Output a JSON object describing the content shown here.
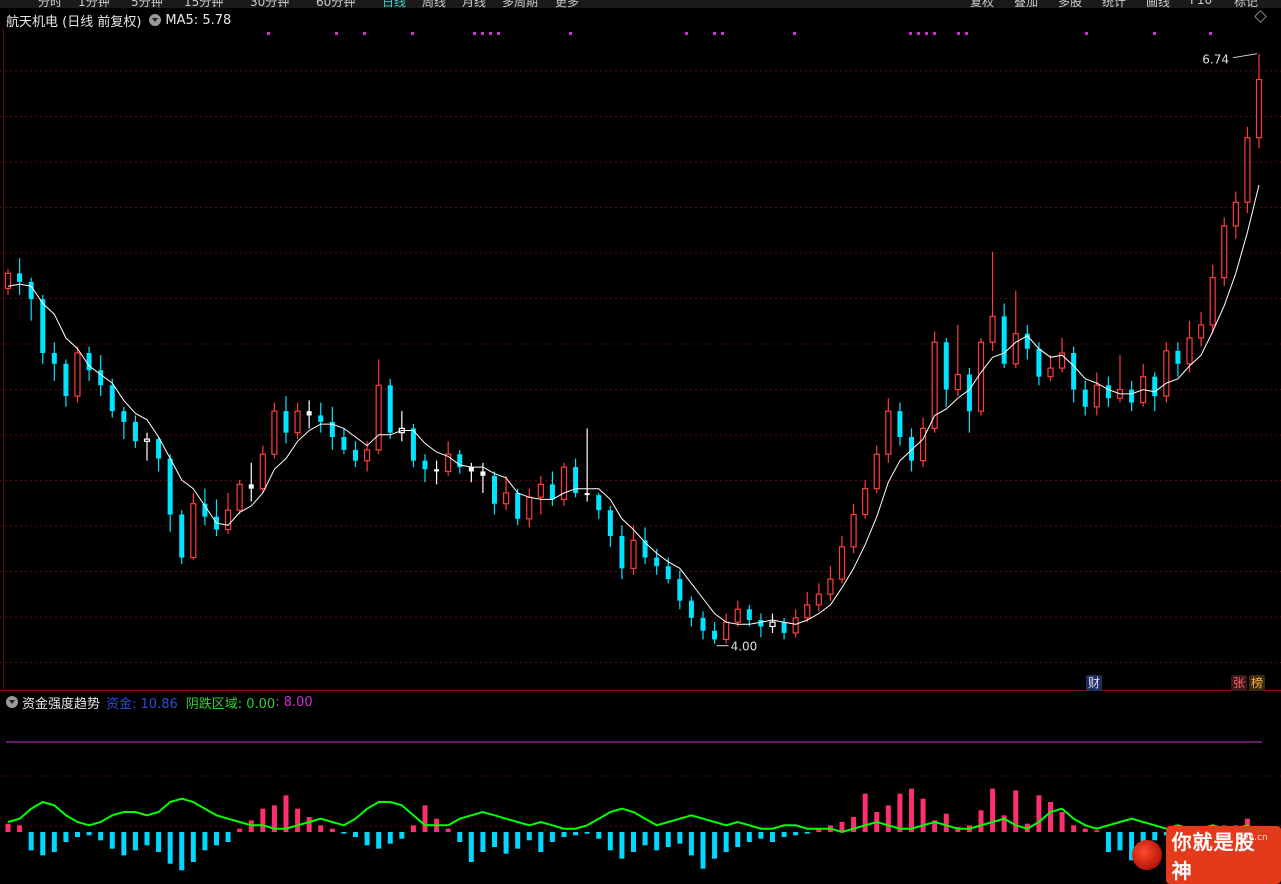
{
  "toolbar": {
    "left_tabs": [
      "分时",
      "1分钟",
      "5分钟",
      "15分钟",
      "30分钟",
      "60分钟",
      "日线",
      "周线",
      "月线",
      "多周期",
      "更多"
    ],
    "right_tabs": [
      "复权",
      "叠加",
      "多股",
      "统计",
      "画线",
      "F10",
      "标记"
    ],
    "active": "日线"
  },
  "main_header": {
    "stock": "航天机电 (日线 前复权)",
    "ma_label": "MA5: 5.78"
  },
  "sub_header": {
    "indicator": "资金强度趋势",
    "fund_label": "资金: 10.86",
    "neg_label": "阴跌区域: 0.00",
    "level_label": ": 8.00"
  },
  "tags": {
    "cai": "财",
    "zhang": "张",
    "bang": "榜"
  },
  "watermark": {
    "text": "你就是股神",
    "url": "694.cn"
  },
  "colors": {
    "up": "#ff3b3b",
    "down": "#00e5ff",
    "doji": "#ffffff",
    "ma": "#ffffff",
    "line_green": "#00ff00",
    "line_purple": "#d030d0",
    "bar_pos": "#ff2e6c",
    "bar_neg": "#00d8ff",
    "grid": "#5a0a0a"
  },
  "chart_data": [
    {
      "type": "candlestick",
      "title": "航天机电 (日线 前复权)",
      "series_name": "MA5",
      "ylim": [
        3.85,
        6.85
      ],
      "high_label": "6.74",
      "low_label": "4.00",
      "candles": [
        [
          5.65,
          5.72,
          5.74,
          5.62
        ],
        [
          5.72,
          5.68,
          5.79,
          5.62
        ],
        [
          5.68,
          5.6,
          5.7,
          5.5
        ],
        [
          5.6,
          5.35,
          5.62,
          5.3
        ],
        [
          5.35,
          5.3,
          5.4,
          5.22
        ],
        [
          5.3,
          5.15,
          5.32,
          5.1
        ],
        [
          5.15,
          5.35,
          5.38,
          5.12
        ],
        [
          5.35,
          5.27,
          5.38,
          5.22
        ],
        [
          5.27,
          5.2,
          5.34,
          5.15
        ],
        [
          5.2,
          5.08,
          5.23,
          5.05
        ],
        [
          5.08,
          5.03,
          5.1,
          4.95
        ],
        [
          5.03,
          4.94,
          5.06,
          4.91
        ],
        [
          4.94,
          4.95,
          4.98,
          4.85
        ],
        [
          4.95,
          4.86,
          4.96,
          4.8
        ],
        [
          4.86,
          4.6,
          4.88,
          4.52
        ],
        [
          4.6,
          4.4,
          4.62,
          4.37
        ],
        [
          4.4,
          4.65,
          4.7,
          4.39
        ],
        [
          4.65,
          4.59,
          4.72,
          4.55
        ],
        [
          4.59,
          4.53,
          4.67,
          4.5
        ],
        [
          4.53,
          4.62,
          4.7,
          4.51
        ],
        [
          4.62,
          4.74,
          4.76,
          4.6
        ],
        [
          4.74,
          4.72,
          4.84,
          4.66
        ],
        [
          4.72,
          4.88,
          4.92,
          4.7
        ],
        [
          4.88,
          5.08,
          5.12,
          4.86
        ],
        [
          5.08,
          4.98,
          5.15,
          4.93
        ],
        [
          4.98,
          5.08,
          5.12,
          4.95
        ],
        [
          5.08,
          5.06,
          5.13,
          5.0
        ],
        [
          5.06,
          5.03,
          5.12,
          4.98
        ],
        [
          5.03,
          4.96,
          5.1,
          4.9
        ],
        [
          4.96,
          4.9,
          5.0,
          4.88
        ],
        [
          4.9,
          4.85,
          4.94,
          4.82
        ],
        [
          4.85,
          4.9,
          4.94,
          4.8
        ],
        [
          4.9,
          5.2,
          5.32,
          4.88
        ],
        [
          5.2,
          4.98,
          5.23,
          4.95
        ],
        [
          4.98,
          5.0,
          5.08,
          4.94
        ],
        [
          5.0,
          4.85,
          5.02,
          4.82
        ],
        [
          4.85,
          4.81,
          4.88,
          4.75
        ],
        [
          4.81,
          4.8,
          4.85,
          4.74
        ],
        [
          4.8,
          4.88,
          4.94,
          4.78
        ],
        [
          4.88,
          4.82,
          4.9,
          4.79
        ],
        [
          4.82,
          4.8,
          4.84,
          4.75
        ],
        [
          4.8,
          4.78,
          4.84,
          4.7
        ],
        [
          4.78,
          4.65,
          4.8,
          4.6
        ],
        [
          4.65,
          4.7,
          4.78,
          4.62
        ],
        [
          4.7,
          4.58,
          4.72,
          4.55
        ],
        [
          4.58,
          4.68,
          4.72,
          4.54
        ],
        [
          4.68,
          4.74,
          4.78,
          4.6
        ],
        [
          4.74,
          4.67,
          4.8,
          4.64
        ],
        [
          4.67,
          4.82,
          4.84,
          4.64
        ],
        [
          4.82,
          4.7,
          4.86,
          4.68
        ],
        [
          4.7,
          4.69,
          5.0,
          4.66
        ],
        [
          4.69,
          4.62,
          4.7,
          4.58
        ],
        [
          4.62,
          4.5,
          4.64,
          4.45
        ],
        [
          4.5,
          4.35,
          4.55,
          4.3
        ],
        [
          4.35,
          4.48,
          4.55,
          4.32
        ],
        [
          4.48,
          4.4,
          4.54,
          4.37
        ],
        [
          4.4,
          4.36,
          4.44,
          4.32
        ],
        [
          4.36,
          4.3,
          4.4,
          4.28
        ],
        [
          4.3,
          4.2,
          4.34,
          4.16
        ],
        [
          4.2,
          4.12,
          4.22,
          4.08
        ],
        [
          4.12,
          4.06,
          4.15,
          4.02
        ],
        [
          4.06,
          4.02,
          4.1,
          4.0
        ],
        [
          4.02,
          4.1,
          4.14,
          4.0
        ],
        [
          4.1,
          4.16,
          4.2,
          4.08
        ],
        [
          4.16,
          4.11,
          4.18,
          4.08
        ],
        [
          4.11,
          4.08,
          4.14,
          4.03
        ],
        [
          4.08,
          4.1,
          4.14,
          4.05
        ],
        [
          4.1,
          4.05,
          4.12,
          4.02
        ],
        [
          4.05,
          4.12,
          4.16,
          4.03
        ],
        [
          4.12,
          4.18,
          4.24,
          4.1
        ],
        [
          4.18,
          4.23,
          4.28,
          4.15
        ],
        [
          4.23,
          4.3,
          4.36,
          4.2
        ],
        [
          4.3,
          4.45,
          4.5,
          4.28
        ],
        [
          4.45,
          4.6,
          4.65,
          4.42
        ],
        [
          4.6,
          4.72,
          4.76,
          4.58
        ],
        [
          4.72,
          4.88,
          4.92,
          4.7
        ],
        [
          4.88,
          5.08,
          5.14,
          4.84
        ],
        [
          5.08,
          4.96,
          5.12,
          4.92
        ],
        [
          4.96,
          4.85,
          5.0,
          4.8
        ],
        [
          4.85,
          5.0,
          5.05,
          4.82
        ],
        [
          5.0,
          5.4,
          5.45,
          4.98
        ],
        [
          5.4,
          5.18,
          5.42,
          5.1
        ],
        [
          5.18,
          5.25,
          5.48,
          5.15
        ],
        [
          5.25,
          5.08,
          5.28,
          4.98
        ],
        [
          5.08,
          5.4,
          5.42,
          5.06
        ],
        [
          5.4,
          5.52,
          5.82,
          5.36
        ],
        [
          5.52,
          5.3,
          5.58,
          5.28
        ],
        [
          5.3,
          5.44,
          5.64,
          5.28
        ],
        [
          5.44,
          5.37,
          5.48,
          5.32
        ],
        [
          5.37,
          5.24,
          5.4,
          5.2
        ],
        [
          5.24,
          5.28,
          5.34,
          5.22
        ],
        [
          5.28,
          5.35,
          5.42,
          5.26
        ],
        [
          5.35,
          5.18,
          5.38,
          5.12
        ],
        [
          5.18,
          5.1,
          5.22,
          5.06
        ],
        [
          5.1,
          5.2,
          5.26,
          5.06
        ],
        [
          5.2,
          5.14,
          5.24,
          5.1
        ],
        [
          5.14,
          5.18,
          5.34,
          5.12
        ],
        [
          5.18,
          5.12,
          5.22,
          5.08
        ],
        [
          5.12,
          5.24,
          5.3,
          5.1
        ],
        [
          5.24,
          5.15,
          5.26,
          5.08
        ],
        [
          5.15,
          5.36,
          5.4,
          5.12
        ],
        [
          5.36,
          5.3,
          5.4,
          5.24
        ],
        [
          5.3,
          5.42,
          5.5,
          5.26
        ],
        [
          5.42,
          5.48,
          5.54,
          5.38
        ],
        [
          5.48,
          5.7,
          5.76,
          5.44
        ],
        [
          5.7,
          5.94,
          5.98,
          5.66
        ],
        [
          5.94,
          6.05,
          6.1,
          5.88
        ],
        [
          6.05,
          6.35,
          6.4,
          6.0
        ],
        [
          6.35,
          6.62,
          6.74,
          6.3
        ]
      ],
      "ma5": [
        5.66,
        5.67,
        5.66,
        5.58,
        5.53,
        5.42,
        5.37,
        5.29,
        5.25,
        5.21,
        5.13,
        5.07,
        5.04,
        4.96,
        4.86,
        4.76,
        4.72,
        4.64,
        4.56,
        4.55,
        4.61,
        4.64,
        4.7,
        4.81,
        4.86,
        4.94,
        4.99,
        5.02,
        5.02,
        5.0,
        4.96,
        4.92,
        4.97,
        4.97,
        4.99,
        4.99,
        4.93,
        4.89,
        4.87,
        4.83,
        4.82,
        4.82,
        4.79,
        4.77,
        4.7,
        4.68,
        4.67,
        4.67,
        4.7,
        4.72,
        4.72,
        4.72,
        4.67,
        4.58,
        4.53,
        4.47,
        4.42,
        4.38,
        4.35,
        4.28,
        4.21,
        4.14,
        4.1,
        4.09,
        4.09,
        4.1,
        4.11,
        4.1,
        4.09,
        4.11,
        4.14,
        4.18,
        4.26,
        4.35,
        4.46,
        4.59,
        4.75,
        4.85,
        4.9,
        4.95,
        5.06,
        5.09,
        5.14,
        5.18,
        5.26,
        5.33,
        5.35,
        5.4,
        5.43,
        5.37,
        5.33,
        5.34,
        5.29,
        5.23,
        5.21,
        5.18,
        5.16,
        5.16,
        5.18,
        5.17,
        5.21,
        5.23,
        5.29,
        5.34,
        5.45,
        5.57,
        5.72,
        5.91,
        6.13
      ]
    },
    {
      "type": "bar",
      "title": "资金强度趋势",
      "ylim": [
        -1.2,
        3.6
      ],
      "level": 2.7,
      "values": [
        0.25,
        0.2,
        -0.55,
        -0.7,
        -0.6,
        -0.3,
        -0.15,
        -0.1,
        -0.25,
        -0.5,
        -0.7,
        -0.55,
        -0.4,
        -0.6,
        -0.95,
        -1.15,
        -0.9,
        -0.55,
        -0.4,
        -0.3,
        0.1,
        0.35,
        0.7,
        0.8,
        1.1,
        0.7,
        0.45,
        0.2,
        0.1,
        -0.05,
        -0.15,
        -0.4,
        -0.5,
        -0.35,
        -0.2,
        0.2,
        0.8,
        0.4,
        0.1,
        -0.3,
        -0.9,
        -0.6,
        -0.45,
        -0.65,
        -0.5,
        -0.25,
        -0.6,
        -0.3,
        -0.15,
        -0.1,
        -0.05,
        -0.2,
        -0.55,
        -0.8,
        -0.6,
        -0.4,
        -0.55,
        -0.45,
        -0.35,
        -0.7,
        -1.1,
        -0.8,
        -0.6,
        -0.45,
        -0.3,
        -0.2,
        -0.3,
        -0.15,
        -0.1,
        -0.05,
        0.1,
        0.2,
        0.3,
        0.45,
        1.15,
        0.6,
        0.8,
        1.15,
        1.3,
        1.0,
        0.35,
        0.55,
        0.15,
        0.2,
        0.65,
        1.3,
        0.5,
        1.25,
        0.25,
        1.1,
        0.9,
        0.6,
        0.2,
        0.1,
        0.05,
        -0.6,
        -0.55,
        -0.85,
        -0.4,
        -0.25,
        -0.1,
        -0.3,
        -0.15,
        -0.5,
        -0.25,
        0.2,
        0.2,
        0.4,
        -0.55
      ],
      "line": [
        0.3,
        0.4,
        0.7,
        0.9,
        0.8,
        0.5,
        0.3,
        0.2,
        0.3,
        0.5,
        0.6,
        0.6,
        0.5,
        0.6,
        0.9,
        1.0,
        0.9,
        0.7,
        0.5,
        0.4,
        0.3,
        0.2,
        0.2,
        0.1,
        0.1,
        0.2,
        0.3,
        0.4,
        0.3,
        0.2,
        0.4,
        0.7,
        0.9,
        0.9,
        0.8,
        0.5,
        0.2,
        0.2,
        0.2,
        0.4,
        0.5,
        0.6,
        0.5,
        0.4,
        0.3,
        0.2,
        0.3,
        0.2,
        0.1,
        0.1,
        0.2,
        0.4,
        0.6,
        0.7,
        0.6,
        0.4,
        0.2,
        0.3,
        0.4,
        0.5,
        0.4,
        0.3,
        0.2,
        0.3,
        0.2,
        0.1,
        0.1,
        0.2,
        0.2,
        0.1,
        0.1,
        0.1,
        0.0,
        0.1,
        0.2,
        0.3,
        0.2,
        0.1,
        0.1,
        0.2,
        0.3,
        0.2,
        0.1,
        0.1,
        0.2,
        0.3,
        0.4,
        0.2,
        0.1,
        0.3,
        0.6,
        0.7,
        0.4,
        0.2,
        0.1,
        0.2,
        0.3,
        0.4,
        0.3,
        0.2,
        0.1,
        0.2,
        0.1,
        0.1,
        0.2,
        0.1,
        0.1,
        0.2,
        0.0
      ]
    }
  ]
}
